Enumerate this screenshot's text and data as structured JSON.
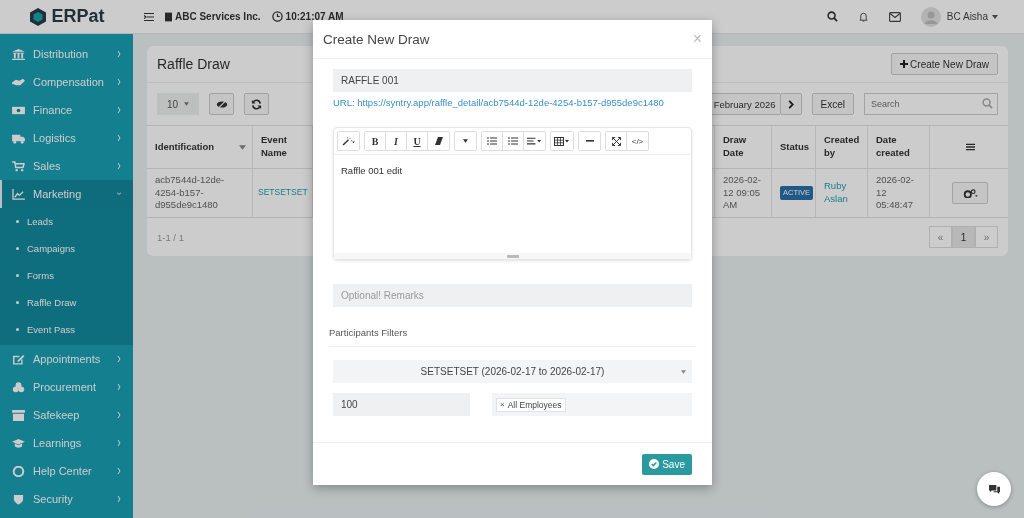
{
  "topbar": {
    "logo": "ERPat",
    "company": "ABC Services Inc.",
    "time": "10:21:07 AM",
    "user": "BC Aisha"
  },
  "sidebar": {
    "items": [
      {
        "label": "Distribution",
        "selected": false
      },
      {
        "label": "Compensation",
        "selected": false
      },
      {
        "label": "Finance",
        "selected": false
      },
      {
        "label": "Logistics",
        "selected": false
      },
      {
        "label": "Sales",
        "selected": false
      },
      {
        "label": "Marketing",
        "selected": true,
        "children": [
          {
            "label": "Leads"
          },
          {
            "label": "Campaigns"
          },
          {
            "label": "Forms"
          },
          {
            "label": "Raffle Draw"
          },
          {
            "label": "Event Pass"
          }
        ]
      },
      {
        "label": "Appointments",
        "selected": false
      },
      {
        "label": "Procurement",
        "selected": false
      },
      {
        "label": "Safekeep",
        "selected": false
      },
      {
        "label": "Learnings",
        "selected": false
      },
      {
        "label": "Help Center",
        "selected": false
      },
      {
        "label": "Security",
        "selected": false
      }
    ]
  },
  "page": {
    "title": "Raffle Draw",
    "create_button": "Create New Draw",
    "page_size": "10",
    "month": "February 2026",
    "excel_button": "Excel",
    "search_placeholder": "Search",
    "columns": [
      {
        "label": "Identification",
        "sortable": true
      },
      {
        "label": "Event Name",
        "sortable": false
      },
      {
        "label": "Draw Date",
        "sortable": false
      },
      {
        "label": "Status",
        "sortable": false
      },
      {
        "label": "Created by",
        "sortable": false
      },
      {
        "label": "Date created",
        "sortable": false
      }
    ],
    "rows": [
      {
        "identification": "acb7544d-12de-4254-b157-d955de9c1480",
        "event_name": "SETSETSET",
        "draw_date": "2026-02-12 09:05 AM",
        "status": "ACTIVE",
        "created_by": "Ruby Aslan",
        "date_created": "2026-02-12 05:48:47"
      }
    ],
    "range": "1-1 / 1",
    "pagination": {
      "first": "«",
      "last": "»",
      "pages": [
        {
          "label": "1",
          "selected": true
        }
      ]
    }
  },
  "modal": {
    "title": "Create New Draw",
    "close": "×",
    "name_value": "RAFFLE 001",
    "url": "URL: https://syntry.app/raffle_detail/acb7544d-12de-4254-b157-d955de9c1480",
    "editor_buttons": [
      "B",
      "I",
      "U",
      "</>"
    ],
    "editor_text": "Raffle 001 edit",
    "remarks_placeholder": "Optional! Remarks",
    "section": "Participants Filters",
    "event_select": "SETSETSET (2026-02-17 to 2026-02-17)",
    "count_value": "100",
    "tags": [
      {
        "label": "All Employees",
        "remove": "×"
      }
    ],
    "save_button": "Save"
  }
}
